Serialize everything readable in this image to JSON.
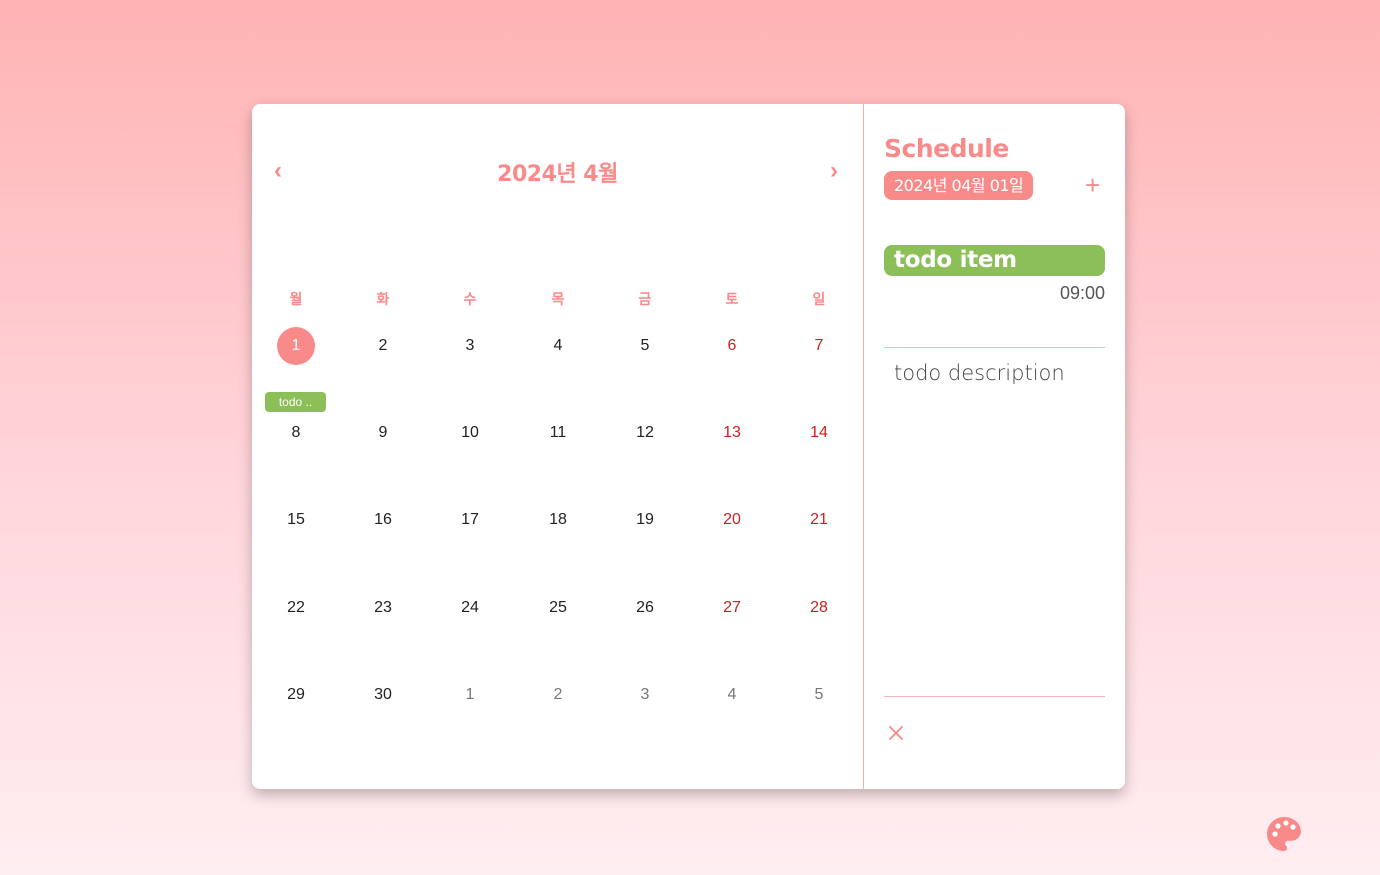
{
  "calendar": {
    "prev_label": "‹",
    "next_label": "›",
    "month_title": "2024년 4월",
    "weekdays": [
      "월",
      "화",
      "수",
      "목",
      "금",
      "토",
      "일"
    ],
    "weeks": [
      [
        "1",
        "2",
        "3",
        "4",
        "5",
        "6",
        "7"
      ],
      [
        "8",
        "9",
        "10",
        "11",
        "12",
        "13",
        "14"
      ],
      [
        "15",
        "16",
        "17",
        "18",
        "19",
        "20",
        "21"
      ],
      [
        "22",
        "23",
        "24",
        "25",
        "26",
        "27",
        "28"
      ],
      [
        "29",
        "30",
        "1",
        "2",
        "3",
        "4",
        "5"
      ]
    ],
    "selected_day": "1",
    "event_chip": "todo .."
  },
  "schedule": {
    "title": "Schedule",
    "date": "2024년 04월 01일",
    "add_label": "+",
    "todo_title": "todo item",
    "todo_time": "09:00",
    "todo_description": "todo description"
  },
  "colors": {
    "accent": "#f98a8a",
    "todo_green": "#8cbf58",
    "weekend_red": "#cc1f1f"
  },
  "icons": [
    "close-icon",
    "edit-icon",
    "delete-icon",
    "palette-icon"
  ]
}
